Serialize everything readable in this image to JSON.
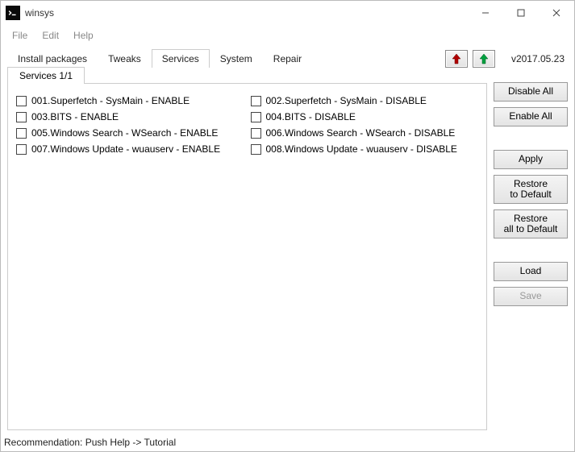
{
  "window": {
    "title": "winsys"
  },
  "menu": {
    "file": "File",
    "edit": "Edit",
    "help": "Help"
  },
  "tabs": {
    "install": "Install packages",
    "tweaks": "Tweaks",
    "services": "Services",
    "system": "System",
    "repair": "Repair"
  },
  "version": "v2017.05.23",
  "subtab": "Services 1/1",
  "items": {
    "col1": [
      "001.Superfetch - SysMain - ENABLE",
      "003.BITS - ENABLE",
      "005.Windows Search - WSearch - ENABLE",
      "007.Windows Update - wuauserv - ENABLE"
    ],
    "col2": [
      "002.Superfetch - SysMain - DISABLE",
      "004.BITS - DISABLE",
      "006.Windows Search - WSearch - DISABLE",
      "008.Windows Update - wuauserv - DISABLE"
    ]
  },
  "buttons": {
    "disable_all": "Disable All",
    "enable_all": "Enable All",
    "apply": "Apply",
    "restore_default": "Restore\nto Default",
    "restore_all_default": "Restore\nall to Default",
    "load": "Load",
    "save": "Save"
  },
  "status": "Recommendation: Push Help -> Tutorial"
}
